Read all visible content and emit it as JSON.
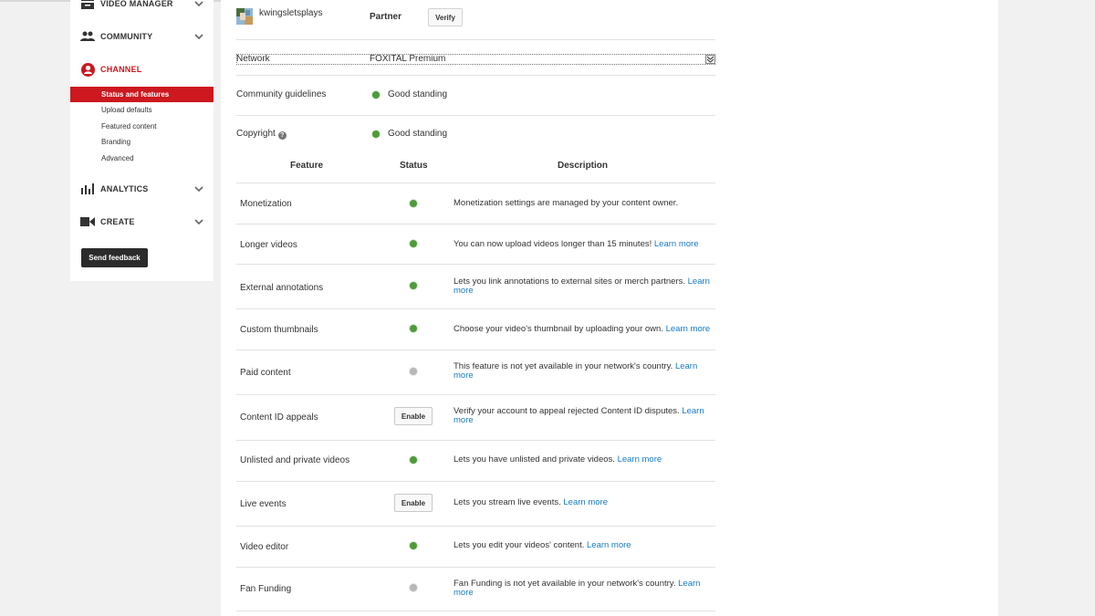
{
  "sidebar": {
    "video_manager": "VIDEO MANAGER",
    "community": "COMMUNITY",
    "channel": "CHANNEL",
    "channel_items": [
      "Status and features",
      "Upload defaults",
      "Featured content",
      "Branding",
      "Advanced"
    ],
    "analytics": "ANALYTICS",
    "create": "CREATE",
    "send_feedback": "Send feedback"
  },
  "account": {
    "channel_name": "kwingsletsplays",
    "partner_label": "Partner",
    "verify_label": "Verify",
    "network_label": "Network",
    "network_value": "FOXITAL Premium",
    "community_label": "Community guidelines",
    "community_status": "Good standing",
    "copyright_label": "Copyright",
    "copyright_status": "Good standing",
    "help_glyph": "?"
  },
  "table": {
    "headers": {
      "feature": "Feature",
      "status": "Status",
      "description": "Description"
    },
    "rows": [
      {
        "feature": "Monetization",
        "status": "enabled",
        "description": "Monetization settings are managed by your content owner.",
        "learn": ""
      },
      {
        "feature": "Longer videos",
        "status": "enabled",
        "description": "You can now upload videos longer than 15 minutes!",
        "learn": "Learn more"
      },
      {
        "feature": "External annotations",
        "status": "enabled",
        "description": "Lets you link annotations to external sites or merch partners.",
        "learn": "Learn more"
      },
      {
        "feature": "Custom thumbnails",
        "status": "enabled",
        "description": "Choose your video's thumbnail by uploading your own.",
        "learn": "Learn more"
      },
      {
        "feature": "Paid content",
        "status": "unavailable",
        "description": "This feature is not yet available in your network's country.",
        "learn": "Learn more"
      },
      {
        "feature": "Content ID appeals",
        "status": "button",
        "button_label": "Enable",
        "description": "Verify your account to appeal rejected Content ID disputes.",
        "learn": "Learn more"
      },
      {
        "feature": "Unlisted and private videos",
        "status": "enabled",
        "description": "Lets you have unlisted and private videos.",
        "learn": "Learn more"
      },
      {
        "feature": "Live events",
        "status": "button",
        "button_label": "Enable",
        "description": "Lets you stream live events.",
        "learn": "Learn more"
      },
      {
        "feature": "Video editor",
        "status": "enabled",
        "description": "Lets you edit your videos' content.",
        "learn": "Learn more"
      },
      {
        "feature": "Fan Funding",
        "status": "unavailable",
        "description": "Fan Funding is not yet available in your network's country.",
        "learn": "Learn more"
      }
    ]
  },
  "colors": {
    "accent": "#cc181e",
    "status_on": "#4e9b3a",
    "status_off": "#b8b8b8",
    "link": "#167ac6"
  }
}
